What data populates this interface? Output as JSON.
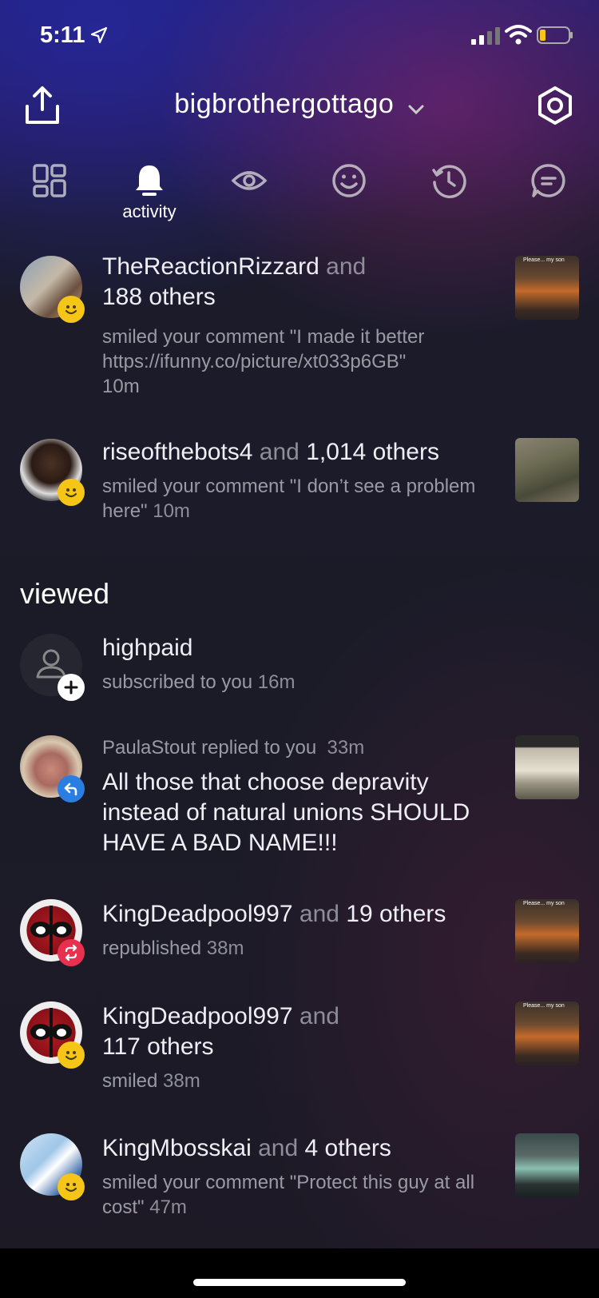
{
  "status_bar": {
    "time": "5:11"
  },
  "header": {
    "title": "bigbrothergottago"
  },
  "tabs": [
    {
      "name": "grid",
      "label": ""
    },
    {
      "name": "activity",
      "label": "activity"
    },
    {
      "name": "viewed",
      "label": ""
    },
    {
      "name": "smiles",
      "label": ""
    },
    {
      "name": "history",
      "label": ""
    },
    {
      "name": "chats",
      "label": ""
    }
  ],
  "activity": [
    {
      "user": "TheReactionRizzard",
      "conj": " and",
      "others": "188 others",
      "action": "smiled your comment \"I made it better https://ifunny.co/picture/xt033p6GB\"",
      "time": "10m"
    },
    {
      "user": "riseofthebots4",
      "conj": " and ",
      "others": "1,014 others",
      "action": "smiled your comment \"I don’t see a problem here\"",
      "time": "10m"
    }
  ],
  "viewed_section": {
    "title": "viewed"
  },
  "viewed": [
    {
      "user": "highpaid",
      "action": "subscribed to you",
      "time": "16m"
    },
    {
      "header": "PaulaStout replied to you",
      "time": "33m",
      "reply": "All those that choose depravity instead of natural unions SHOULD HAVE A BAD NAME!!!"
    },
    {
      "user": "KingDeadpool997",
      "conj": " and ",
      "others": "19 others",
      "action": "republished",
      "time": "38m"
    },
    {
      "user": "KingDeadpool997",
      "conj": " and",
      "others": "117 others",
      "action": "smiled",
      "time": "38m"
    },
    {
      "user": "KingMbosskai",
      "conj": " and ",
      "others": "4 others",
      "action": "smiled your comment \"Protect this guy at all cost\"",
      "time": "47m"
    }
  ],
  "thumb_captions": {
    "please": "Please... my son"
  },
  "colors": {
    "smile_badge": "#f5c518",
    "reply_badge": "#2a7de1",
    "repost_badge": "#e8304f"
  }
}
